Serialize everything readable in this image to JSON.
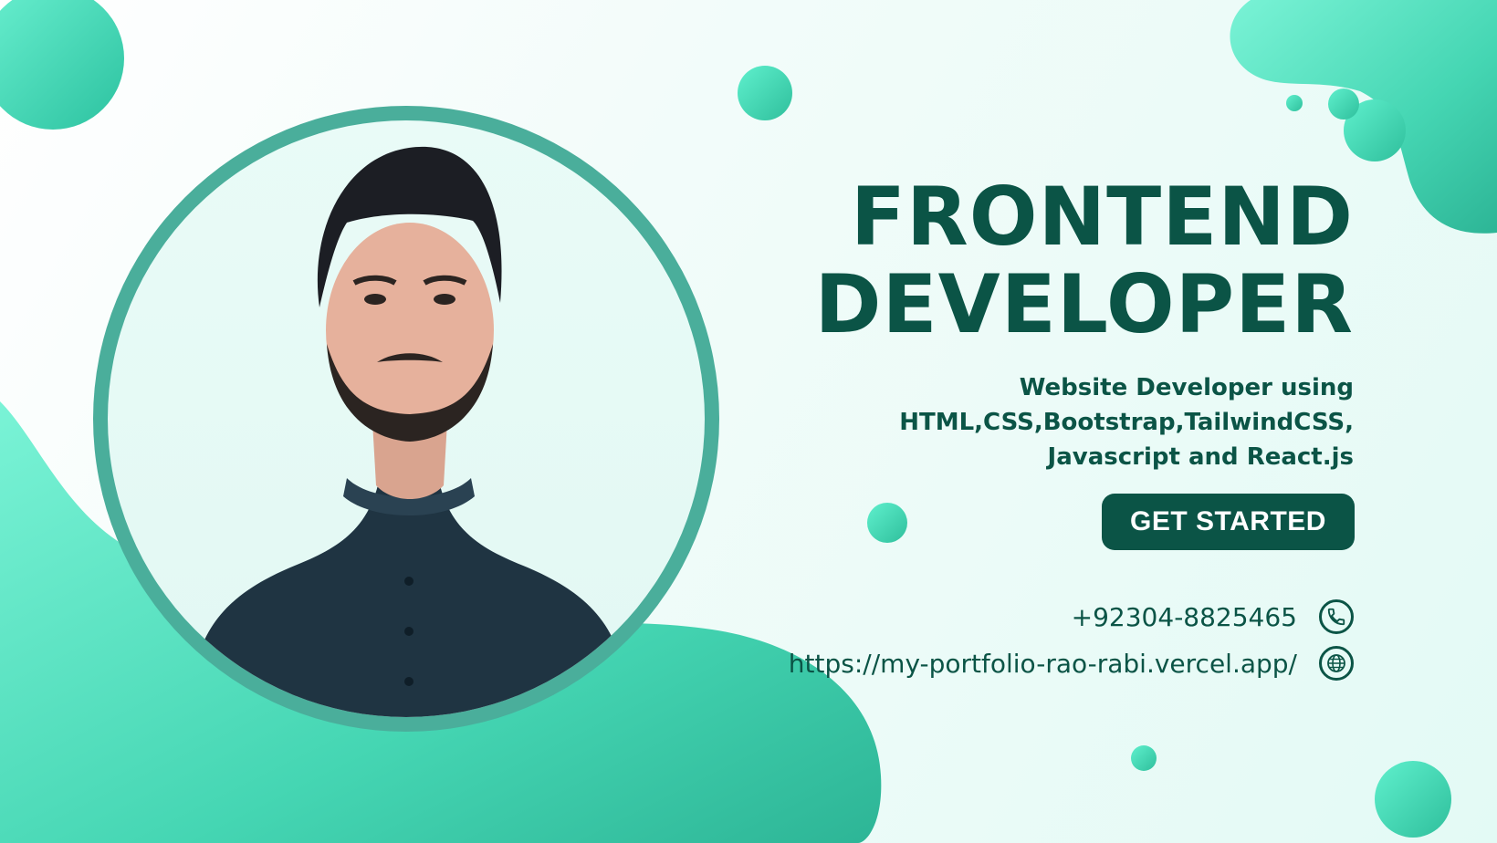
{
  "colors": {
    "accent_dark": "#0b5446",
    "accent_teal": "#4aae9b",
    "accent_mint": "#5ee6c6",
    "background": "#eefbf8"
  },
  "headline": {
    "line1": "FRONTEND",
    "line2": "DEVELOPER"
  },
  "subtitle": {
    "line1": "Website Developer using",
    "line2": "HTML,CSS,Bootstrap,TailwindCSS,",
    "line3": "Javascript and  React.js"
  },
  "cta": {
    "label": "GET STARTED"
  },
  "contact": {
    "phone": {
      "text": "+92304-8825465",
      "icon": "phone-icon"
    },
    "website": {
      "text": "https://my-portfolio-rao-rabi.vercel.app/",
      "icon": "globe-icon"
    }
  },
  "portrait": {
    "icon": "person-photo"
  }
}
